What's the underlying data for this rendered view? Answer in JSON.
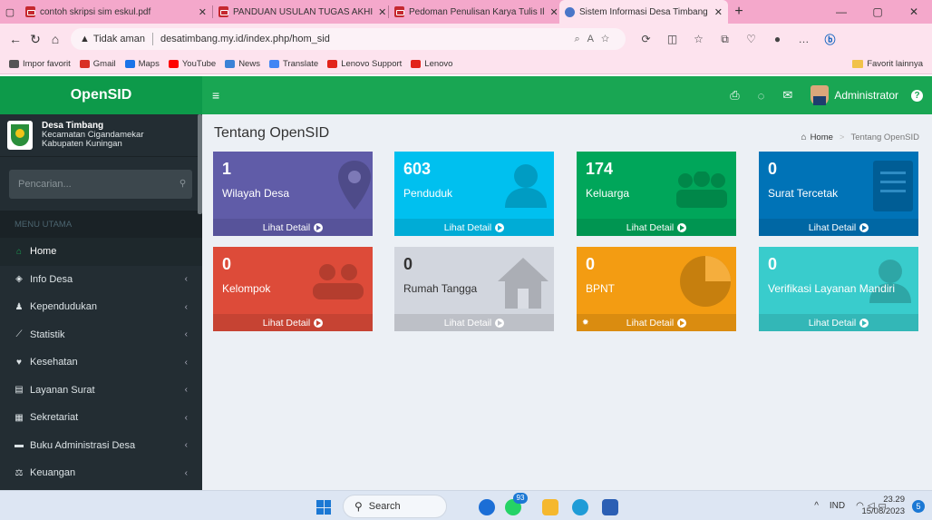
{
  "browser": {
    "tabs": [
      {
        "title": "contoh skripsi sim eskul.pdf"
      },
      {
        "title": "PANDUAN USULAN TUGAS AKHI"
      },
      {
        "title": "Pedoman Penulisan Karya Tulis Il"
      },
      {
        "title": "Sistem Informasi Desa Timbang"
      }
    ],
    "security_label": "Tidak aman",
    "url": "desatimbang.my.id/index.php/hom_sid",
    "favorites": [
      {
        "label": "Impor favorit",
        "color": "#555555"
      },
      {
        "label": "Gmail",
        "color": "#d93025"
      },
      {
        "label": "Maps",
        "color": "#1a73e8"
      },
      {
        "label": "YouTube",
        "color": "#ff0000"
      },
      {
        "label": "News",
        "color": "#3b82d6"
      },
      {
        "label": "Translate",
        "color": "#4285f4"
      },
      {
        "label": "Lenovo Support",
        "color": "#e2231a"
      },
      {
        "label": "Lenovo",
        "color": "#e2231a"
      }
    ],
    "favorites_other": "Favorit lainnya"
  },
  "app": {
    "brand": "OpenSID",
    "admin_name": "Administrator",
    "village": {
      "name": "Desa Timbang",
      "district": "Kecamatan Cigandamekar",
      "regency": "Kabupaten Kuningan"
    },
    "search_placeholder": "Pencarian...",
    "menu_header": "MENU UTAMA",
    "menu": [
      {
        "label": "Home",
        "icon": "home-icon",
        "active": true
      },
      {
        "label": "Info Desa",
        "icon": "sitemap-icon"
      },
      {
        "label": "Kependudukan",
        "icon": "users-icon"
      },
      {
        "label": "Statistik",
        "icon": "chart-icon"
      },
      {
        "label": "Kesehatan",
        "icon": "heartbeat-icon"
      },
      {
        "label": "Layanan Surat",
        "icon": "book-icon"
      },
      {
        "label": "Sekretariat",
        "icon": "archive-icon"
      },
      {
        "label": "Buku Administrasi Desa",
        "icon": "folder-icon"
      },
      {
        "label": "Keuangan",
        "icon": "balance-icon"
      }
    ],
    "page_title": "Tentang OpenSID",
    "breadcrumb": {
      "home": "Home",
      "current": "Tentang OpenSID"
    },
    "cards": [
      {
        "number": "1",
        "label": "Wilayah Desa",
        "footer": "Lihat Detail",
        "color": "#605ca8",
        "footer_color": "#57539a"
      },
      {
        "number": "603",
        "label": "Penduduk",
        "footer": "Lihat Detail",
        "color": "#00c0ef",
        "footer_color": "#00acd6"
      },
      {
        "number": "174",
        "label": "Keluarga",
        "footer": "Lihat Detail",
        "color": "#00a65a",
        "footer_color": "#009551"
      },
      {
        "number": "0",
        "label": "Surat Tercetak",
        "footer": "Lihat Detail",
        "color": "#0073b7",
        "footer_color": "#0067a4"
      },
      {
        "number": "0",
        "label": "Kelompok",
        "footer": "Lihat Detail",
        "color": "#dd4b39",
        "footer_color": "#c64333"
      },
      {
        "number": "0",
        "label": "Rumah Tangga",
        "footer": "Lihat Detail",
        "color": "#d2d6de",
        "footer_color": "#bdc0c7"
      },
      {
        "number": "0",
        "label": "BPNT",
        "footer": "Lihat Detail",
        "color": "#f39c12",
        "footer_color": "#da8c10"
      },
      {
        "number": "0",
        "label": "Verifikasi Layanan Mandiri",
        "footer": "Lihat Detail",
        "color": "#39cccc",
        "footer_color": "#33b7b7"
      }
    ]
  },
  "taskbar": {
    "search_label": "Search",
    "badge": "93",
    "language": "IND",
    "time": "23.29",
    "date": "15/08/2023",
    "notifications": "5"
  }
}
